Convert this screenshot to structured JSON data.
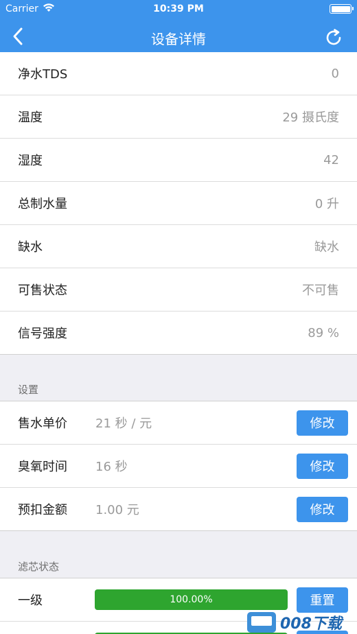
{
  "status_bar": {
    "carrier": "Carrier",
    "time": "10:39 PM"
  },
  "nav": {
    "title": "设备详情",
    "back_icon": "chevron-left-icon",
    "refresh_icon": "refresh-icon"
  },
  "info": [
    {
      "label": "净水TDS",
      "value": "0"
    },
    {
      "label": "温度",
      "value": "29 摄氏度"
    },
    {
      "label": "湿度",
      "value": "42"
    },
    {
      "label": "总制水量",
      "value": "0 升"
    },
    {
      "label": "缺水",
      "value": "缺水"
    },
    {
      "label": "可售状态",
      "value": "不可售"
    },
    {
      "label": "信号强度",
      "value": "89 %"
    }
  ],
  "settings": {
    "title": "设置",
    "items": [
      {
        "label": "售水单价",
        "value": "21 秒 / 元",
        "button": "修改"
      },
      {
        "label": "臭氧时间",
        "value": "16 秒",
        "button": "修改"
      },
      {
        "label": "预扣金额",
        "value": "1.00 元",
        "button": "修改"
      }
    ]
  },
  "filters": {
    "title": "滤芯状态",
    "items": [
      {
        "label": "一级",
        "progress_text": "100.00%",
        "progress": 1.0,
        "button": "重置"
      },
      {
        "label": "",
        "progress_text": "",
        "progress": 1.0,
        "button": ""
      }
    ]
  },
  "watermark": {
    "text": "008下载"
  },
  "colors": {
    "brand": "#3d94ec",
    "progress": "#2ea52f",
    "background": "#efeff4"
  }
}
